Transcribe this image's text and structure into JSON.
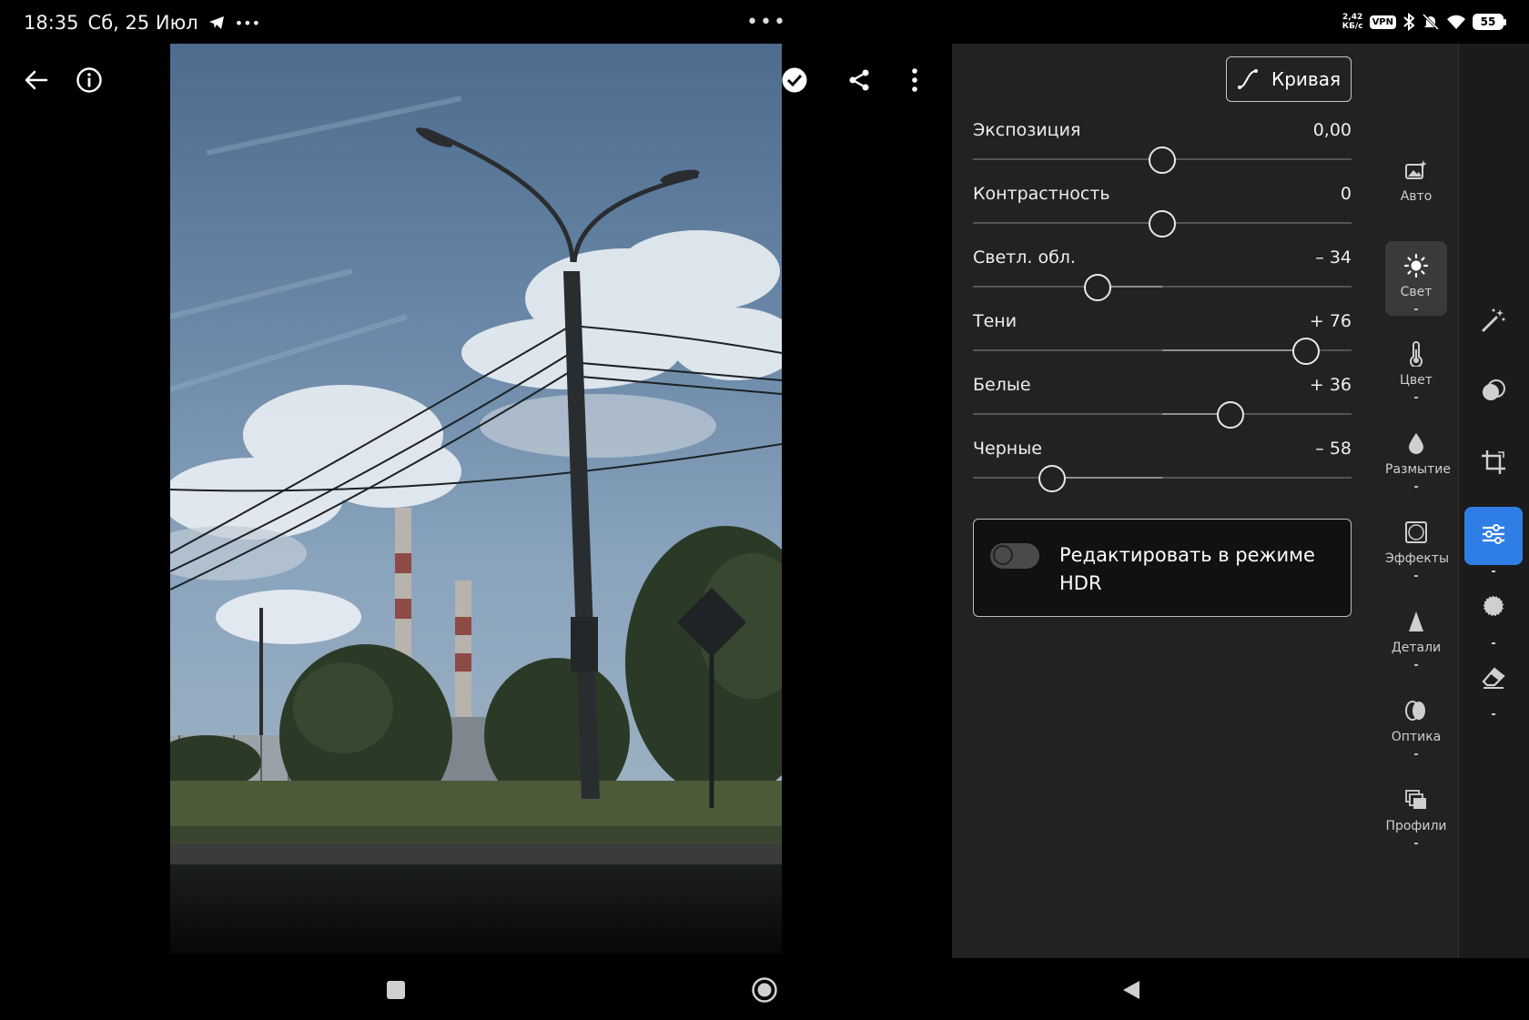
{
  "status": {
    "time": "18:35",
    "date": "Сб, 25 Июл",
    "more_dots": "•••",
    "net_speed_top": "2,42",
    "net_speed_bottom": "КБ/с",
    "vpn": "VPN",
    "battery": "55"
  },
  "toolbar": {
    "back_icon": "arrow-left-icon",
    "info_icon": "info-icon",
    "history_icon": "history-icon",
    "done_icon": "check-circle-icon",
    "share_icon": "share-icon",
    "menu_icon": "more-vertical-icon"
  },
  "panel": {
    "curve_label": "Кривая",
    "sliders": [
      {
        "label": "Экспозиция",
        "value": "0,00",
        "level": 0.0
      },
      {
        "label": "Контрастность",
        "value": "0",
        "level": 0.0
      },
      {
        "label": "Светл. обл.",
        "value": "– 34",
        "level": -0.34
      },
      {
        "label": "Тени",
        "value": "+ 76",
        "level": 0.76
      },
      {
        "label": "Белые",
        "value": "+ 36",
        "level": 0.36
      },
      {
        "label": "Черные",
        "value": "– 58",
        "level": -0.58
      }
    ],
    "hdr_label": "Редактировать в режиме HDR",
    "hdr_enabled": false
  },
  "categories": [
    {
      "label": "Авто",
      "icon": "auto-image-icon",
      "active": false
    },
    {
      "label": "Свет",
      "icon": "sun-icon",
      "active": true
    },
    {
      "label": "Цвет",
      "icon": "thermometer-icon",
      "active": false
    },
    {
      "label": "Размытие",
      "icon": "drop-icon",
      "active": false
    },
    {
      "label": "Эффекты",
      "icon": "vignette-icon",
      "active": false
    },
    {
      "label": "Детали",
      "icon": "triangle-icon",
      "active": false
    },
    {
      "label": "Оптика",
      "icon": "lens-icon",
      "active": false
    },
    {
      "label": "Профили",
      "icon": "profiles-icon",
      "active": false
    }
  ],
  "rail": [
    {
      "icon": "magic-wand-icon",
      "active": false
    },
    {
      "icon": "masking-icon",
      "active": false
    },
    {
      "icon": "crop-icon",
      "active": false
    },
    {
      "icon": "adjust-sliders-icon",
      "active": true
    },
    {
      "icon": "presets-icon",
      "active": false
    },
    {
      "icon": "eraser-icon",
      "active": false
    }
  ],
  "nav": {
    "recents": "square-icon",
    "home": "circle-icon",
    "back": "triangle-back-icon"
  },
  "colors": {
    "panel_bg": "#222222",
    "accent": "#2f7ee6"
  }
}
